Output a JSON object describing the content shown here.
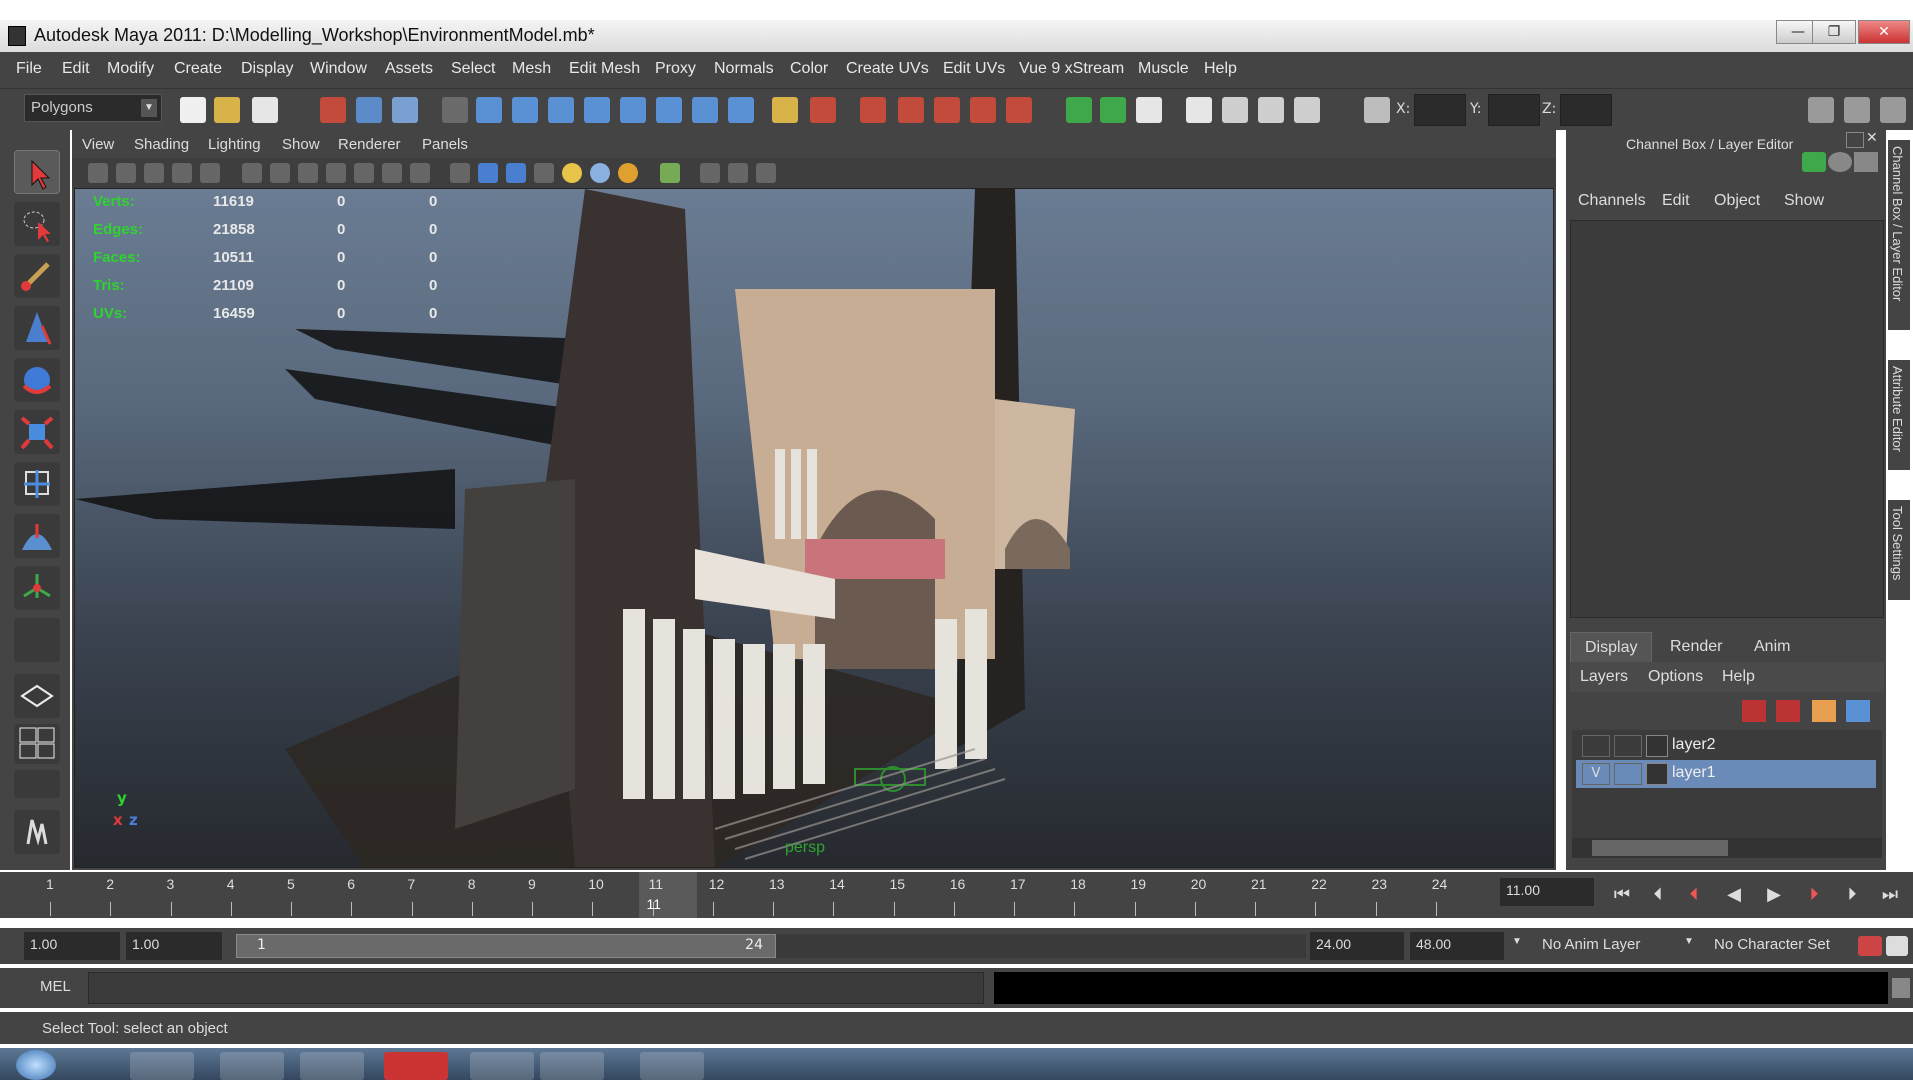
{
  "window": {
    "title": "Autodesk Maya 2011: D:\\Modelling_Workshop\\EnvironmentModel.mb*",
    "minimize": "—",
    "maximize": "❐",
    "close": "✕"
  },
  "menubar": {
    "items": [
      "File",
      "Edit",
      "Modify",
      "Create",
      "Display",
      "Window",
      "Assets",
      "Select",
      "Mesh",
      "Edit Mesh",
      "Proxy",
      "Normals",
      "Color",
      "Create UVs",
      "Edit UVs",
      "Vue 9 xStream",
      "Muscle",
      "Help"
    ]
  },
  "toolbar": {
    "mode": "Polygons",
    "x_label": "X:",
    "y_label": "Y:",
    "z_label": "Z:"
  },
  "viewport": {
    "menus": [
      "View",
      "Shading",
      "Lighting",
      "Show",
      "Renderer",
      "Panels"
    ],
    "hud": [
      {
        "label": "Verts:",
        "v1": "11619",
        "v2": "0",
        "v3": "0"
      },
      {
        "label": "Edges:",
        "v1": "21858",
        "v2": "0",
        "v3": "0"
      },
      {
        "label": "Faces:",
        "v1": "10511",
        "v2": "0",
        "v3": "0"
      },
      {
        "label": "Tris:",
        "v1": "21109",
        "v2": "0",
        "v3": "0"
      },
      {
        "label": "UVs:",
        "v1": "16459",
        "v2": "0",
        "v3": "0"
      }
    ],
    "camera": "persp",
    "axis_y": "y",
    "axis_x": "x",
    "axis_z": "z"
  },
  "channelbox": {
    "title": "Channel Box / Layer Editor",
    "tabs": [
      "Channels",
      "Edit",
      "Object",
      "Show"
    ],
    "layer_tabs": [
      "Display",
      "Render",
      "Anim"
    ],
    "layer_menu": [
      "Layers",
      "Options",
      "Help"
    ],
    "layers": [
      {
        "vis": "",
        "name": "layer2",
        "selected": false
      },
      {
        "vis": "V",
        "name": "layer1",
        "selected": true
      }
    ]
  },
  "sidetabs": [
    "Channel Box / Layer Editor",
    "Attribute Editor",
    "Tool Settings"
  ],
  "timeline": {
    "ticks": [
      "1",
      "2",
      "3",
      "4",
      "5",
      "6",
      "7",
      "8",
      "9",
      "10",
      "11",
      "12",
      "13",
      "14",
      "15",
      "16",
      "17",
      "18",
      "19",
      "20",
      "21",
      "22",
      "23",
      "24"
    ],
    "current_frame": "11",
    "current_frame_field": "11.00"
  },
  "range": {
    "start": "1.00",
    "anim_start": "1.00",
    "slider_start": "1",
    "slider_end": "24",
    "anim_end": "24.00",
    "end": "48.00",
    "anim_layer": "No Anim Layer",
    "char_set": "No Character Set"
  },
  "command": {
    "label": "MEL"
  },
  "help": {
    "text": "Select Tool: select an object"
  }
}
